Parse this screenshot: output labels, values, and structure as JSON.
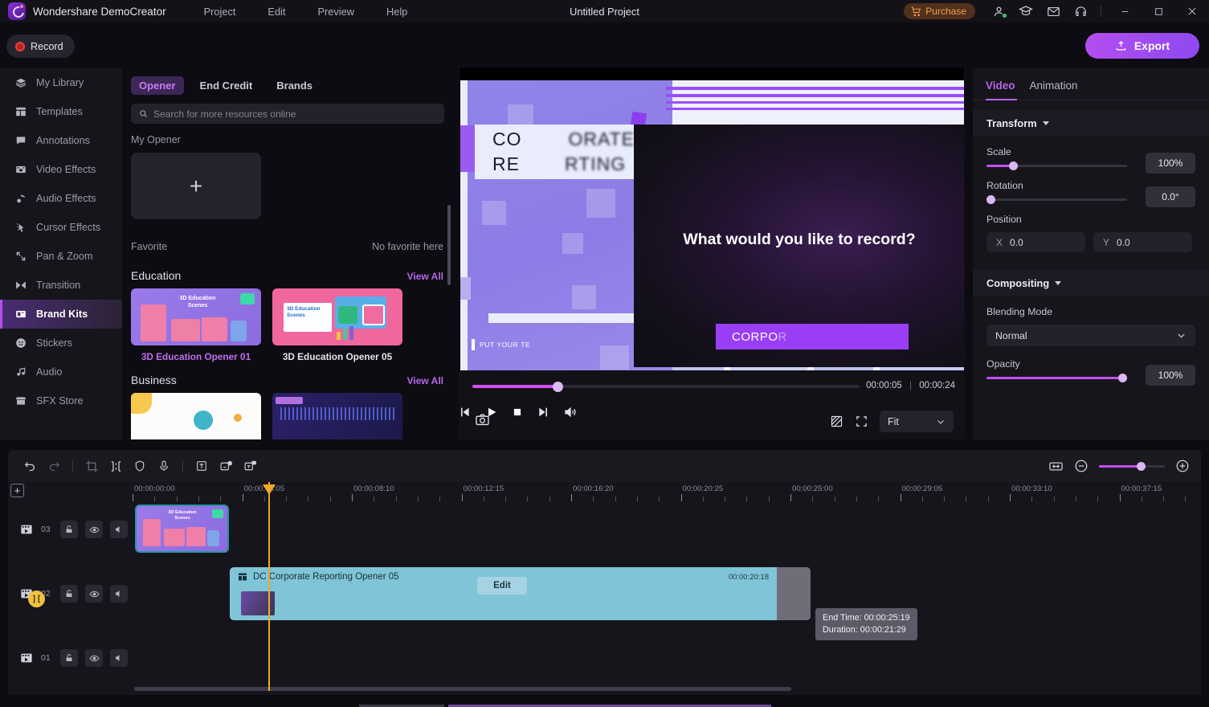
{
  "titlebar": {
    "app_title": "Wondershare DemoCreator",
    "project_title": "Untitled Project",
    "menu": [
      {
        "label": "Project"
      },
      {
        "label": "Edit"
      },
      {
        "label": "Preview"
      },
      {
        "label": "Help"
      }
    ],
    "purchase_label": "Purchase",
    "icons": [
      "cart-icon",
      "account-icon",
      "academy-icon",
      "mail-icon",
      "support-icon"
    ],
    "window_controls": [
      "minimize",
      "maximize",
      "close"
    ]
  },
  "actionbar": {
    "record_label": "Record",
    "export_label": "Export"
  },
  "sidebar": {
    "items": [
      {
        "label": "My Library",
        "icon": "layers-icon",
        "active": false
      },
      {
        "label": "Templates",
        "icon": "template-icon",
        "active": false
      },
      {
        "label": "Annotations",
        "icon": "speech-bubble-icon",
        "active": false
      },
      {
        "label": "Video Effects",
        "icon": "film-strip-icon",
        "active": false
      },
      {
        "label": "Audio Effects",
        "icon": "music-note-icon",
        "active": false
      },
      {
        "label": "Cursor Effects",
        "icon": "cursor-icon",
        "active": false
      },
      {
        "label": "Pan & Zoom",
        "icon": "pan-zoom-icon",
        "active": false
      },
      {
        "label": "Transition",
        "icon": "transition-icon",
        "active": false
      },
      {
        "label": "Brand Kits",
        "icon": "brand-kit-icon",
        "active": true
      },
      {
        "label": "Stickers",
        "icon": "smiley-icon",
        "active": false
      },
      {
        "label": "Audio",
        "icon": "note-icon",
        "active": false
      },
      {
        "label": "SFX Store",
        "icon": "store-icon",
        "active": false
      }
    ]
  },
  "library": {
    "tabs": [
      {
        "label": "Opener",
        "active": true
      },
      {
        "label": "End Credit",
        "active": false
      },
      {
        "label": "Brands",
        "active": false
      }
    ],
    "search_placeholder": "Search for more resources online",
    "my_opener_title": "My Opener",
    "add_tile_label": "+",
    "favorite_title": "Favorite",
    "favorite_empty": "No favorite here",
    "sections": [
      {
        "title": "Education",
        "view_all": "View All",
        "items": [
          {
            "caption": "3D Education Opener 01",
            "selected": true,
            "overlay_text": "3D Education Scenes"
          },
          {
            "caption": "3D Education Opener 05",
            "selected": false,
            "overlay_text": "3D Education Scenes"
          }
        ]
      },
      {
        "title": "Business",
        "view_all": "View All",
        "items": [
          {
            "caption": "",
            "selected": false,
            "overlay_text": ""
          },
          {
            "caption": "",
            "selected": false,
            "overlay_text": ""
          }
        ]
      }
    ]
  },
  "preview": {
    "overlay_prompt": "What would you like to record?",
    "template_word_line1": "CO",
    "template_word_line1b": "ORATE",
    "template_word_line2": "RE",
    "template_word_line2b": "RTING",
    "template_footer": "PUT YOUR TE",
    "corporate_bar": "CORPO",
    "corporate_bar_dim": "R",
    "current_time": "00:00:05",
    "total_time": "00:00:24",
    "controls": [
      {
        "name": "snapshot-button",
        "icon": "camera-icon"
      },
      {
        "name": "previous-frame-button",
        "icon": "step-back-icon"
      },
      {
        "name": "play-button",
        "icon": "play-icon"
      },
      {
        "name": "stop-button",
        "icon": "stop-icon"
      },
      {
        "name": "next-frame-button",
        "icon": "step-forward-icon"
      },
      {
        "name": "volume-button",
        "icon": "speaker-icon"
      },
      {
        "name": "mask-button",
        "icon": "diagonal-square-icon"
      },
      {
        "name": "fullscreen-button",
        "icon": "expand-icon"
      }
    ],
    "zoom_select": "Fit"
  },
  "properties": {
    "tabs": [
      {
        "label": "Video",
        "active": true
      },
      {
        "label": "Animation",
        "active": false
      }
    ],
    "transform": {
      "title": "Transform",
      "scale_label": "Scale",
      "scale_value": "100%",
      "rotation_label": "Rotation",
      "rotation_value": "0.0°",
      "position_label": "Position",
      "x_key": "X",
      "x_value": "0.0",
      "y_key": "Y",
      "y_value": "0.0"
    },
    "compositing": {
      "title": "Compositing",
      "blending_label": "Blending Mode",
      "blending_value": "Normal",
      "opacity_label": "Opacity",
      "opacity_value": "100%"
    }
  },
  "timeline": {
    "toolbar_left": [
      {
        "name": "undo-button",
        "icon": "undo-icon"
      },
      {
        "name": "redo-button",
        "icon": "redo-icon"
      },
      {
        "name": "crop-button",
        "icon": "crop-icon"
      },
      {
        "name": "split-button",
        "icon": "split-icon"
      },
      {
        "name": "shield-button",
        "icon": "shield-icon"
      },
      {
        "name": "voiceover-button",
        "icon": "microphone-icon"
      },
      {
        "name": "text-button",
        "icon": "text-box-icon"
      },
      {
        "name": "speech-to-text-button",
        "icon": "speech-to-text-icon"
      },
      {
        "name": "text-to-speech-button",
        "icon": "text-to-speech-icon"
      }
    ],
    "toolbar_right": [
      {
        "name": "fit-timeline-button",
        "icon": "fit-width-icon"
      },
      {
        "name": "zoom-out-button",
        "icon": "minus-circle-icon"
      },
      {
        "name": "zoom-in-button",
        "icon": "plus-circle-icon"
      }
    ],
    "add_track_label": "+",
    "ruler_labels": [
      "00:00:00:00",
      "00:00:04:05",
      "00:00:08:10",
      "00:00:12:15",
      "00:00:16:20",
      "00:00:20:25",
      "00:00:25:00",
      "00:00:29:05",
      "00:00:33:10",
      "00:00:37:15"
    ],
    "tracks": [
      {
        "number": "03",
        "icons": [
          "film-icon",
          "unlock-icon",
          "eye-icon",
          "mute-icon"
        ]
      },
      {
        "number": "02",
        "icons": [
          "film-icon",
          "unlock-icon",
          "eye-icon",
          "mute-icon"
        ]
      },
      {
        "number": "01",
        "icons": [
          "film-icon",
          "unlock-icon",
          "eye-icon",
          "mute-icon"
        ]
      }
    ],
    "clips": [
      {
        "name": "education-thumbnail-clip",
        "label": "3D Education Scenes",
        "track": "03"
      },
      {
        "name": "corporate-opener-clip",
        "label": "DC Corporate Reporting Opener 05",
        "edit_label": "Edit",
        "duration_stamp": "00:00:20:18",
        "track": "02"
      }
    ],
    "tooltip": {
      "end_time": "End Time: 00:00:25:19",
      "duration": "Duration: 00:00:21:29"
    }
  },
  "colors": {
    "accent_purple": "#b866e8",
    "clip_blue": "#80c4d8",
    "playhead_orange": "#f0a828",
    "record_red": "#e8433f"
  }
}
